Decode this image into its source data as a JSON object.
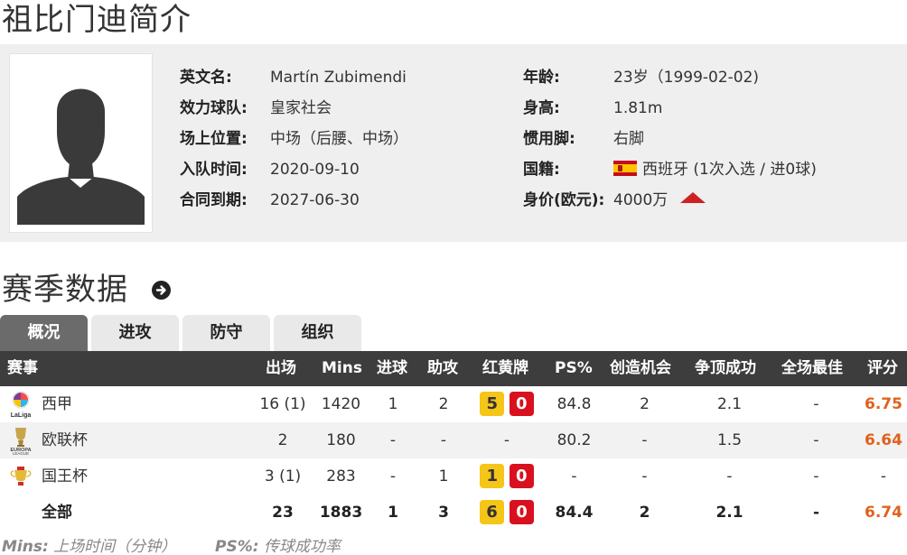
{
  "page_title": "祖比门迪简介",
  "profile": {
    "left": [
      {
        "label": "英文名:",
        "value": "Martín Zubimendi"
      },
      {
        "label": "效力球队:",
        "value": "皇家社会"
      },
      {
        "label": "场上位置:",
        "value": "中场（后腰、中场）"
      },
      {
        "label": "入队时间:",
        "value": "2020-09-10"
      },
      {
        "label": "合同到期:",
        "value": "2027-06-30"
      }
    ],
    "right": [
      {
        "label": "年龄:",
        "value": "23岁（1999-02-02)"
      },
      {
        "label": "身高:",
        "value": "1.81m"
      },
      {
        "label": "惯用脚:",
        "value": "右脚"
      },
      {
        "label": "国籍:",
        "value": "西班牙 (1次入选 / 进0球)"
      },
      {
        "label": "身价(欧元):",
        "value": "4000万"
      }
    ]
  },
  "section_title": "赛季数据",
  "tabs": [
    "概况",
    "进攻",
    "防守",
    "组织"
  ],
  "active_tab": 0,
  "table": {
    "headers": [
      "赛事",
      "出场",
      "Mins",
      "进球",
      "助攻",
      "红黄牌",
      "PS%",
      "创造机会",
      "争顶成功",
      "全场最佳",
      "评分"
    ],
    "rows": [
      {
        "competition": "西甲",
        "apps": "16 (1)",
        "mins": "1420",
        "goals": "1",
        "assists": "2",
        "yellow": "5",
        "red": "0",
        "ps": "84.8",
        "chances": "2",
        "aerials": "2.1",
        "motm": "-",
        "rating": "6.75"
      },
      {
        "competition": "欧联杯",
        "apps": "2",
        "mins": "180",
        "goals": "-",
        "assists": "-",
        "yellow": "",
        "red": "",
        "cards_text": "-",
        "ps": "80.2",
        "chances": "-",
        "aerials": "1.5",
        "motm": "-",
        "rating": "6.64"
      },
      {
        "competition": "国王杯",
        "apps": "3 (1)",
        "mins": "283",
        "goals": "-",
        "assists": "1",
        "yellow": "1",
        "red": "0",
        "ps": "-",
        "chances": "-",
        "aerials": "-",
        "motm": "-",
        "rating": "-"
      }
    ],
    "total": {
      "competition": "全部",
      "apps": "23",
      "mins": "1883",
      "goals": "1",
      "assists": "3",
      "yellow": "6",
      "red": "0",
      "ps": "84.4",
      "chances": "2",
      "aerials": "2.1",
      "motm": "-",
      "rating": "6.74"
    }
  },
  "footnote": {
    "mins_key": "Mins:",
    "mins_desc": "上场时间（分钟）",
    "ps_key": "PS%:",
    "ps_desc": "传球成功率"
  },
  "colors": {
    "rating": "#e0611c",
    "yellow_card": "#f5c518",
    "red_card": "#d9101e",
    "header_bg": "#3d3d3d",
    "active_tab": "#6b6b6b"
  }
}
